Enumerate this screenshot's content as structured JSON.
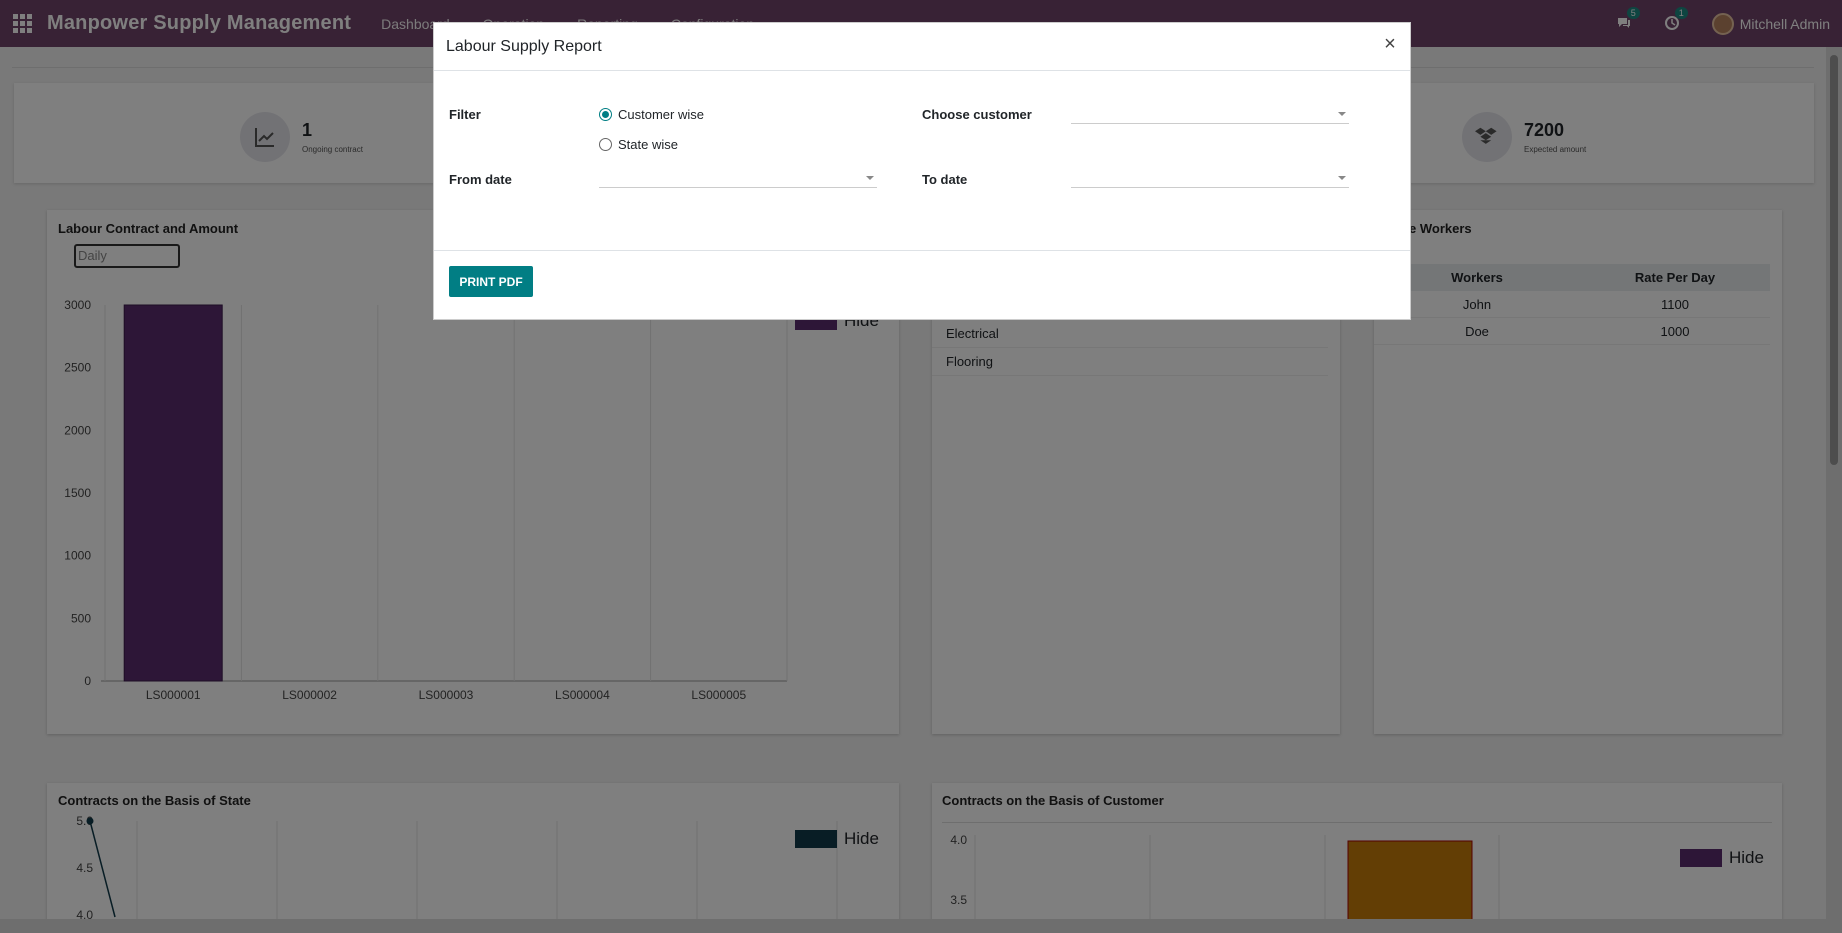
{
  "navbar": {
    "brand": "Manpower Supply Management",
    "menu": [
      "Dashboard",
      "Operation",
      "Reporting",
      "Configuration"
    ],
    "chat_count": "5",
    "activity_count": "1",
    "user_name": "Mitchell Admin"
  },
  "tiles": [
    {
      "value": "1",
      "label": "Ongoing contract",
      "icon": "trend-up-icon"
    },
    {
      "value": "7200",
      "label": "Expected amount",
      "icon": "dropbox-icon"
    }
  ],
  "contract_card": {
    "title": "Labour Contract and Amount",
    "period_select": "Daily",
    "legend": "Hide"
  },
  "category_list": [
    "Electrical",
    "Flooring"
  ],
  "workers_card": {
    "title": "ilable Workers",
    "headers": [
      "Workers",
      "Rate Per Day"
    ],
    "rows": [
      {
        "worker": "John",
        "rate": "1100"
      },
      {
        "worker": "Doe",
        "rate": "1000"
      }
    ]
  },
  "state_card": {
    "title": "Contracts on the Basis of State",
    "legend": "Hide"
  },
  "customer_card": {
    "title": "Contracts on the Basis of Customer",
    "legend": "Hide"
  },
  "modal": {
    "title": "Labour Supply Report",
    "close": "×",
    "filter_label": "Filter",
    "options": [
      "Customer wise",
      "State wise"
    ],
    "selected": "Customer wise",
    "customer_label": "Choose customer",
    "from_label": "From date",
    "to_label": "To date",
    "print_label": "PRINT PDF"
  },
  "colors": {
    "navbar": "#71456a",
    "primary": "#017e84",
    "bar_purple": "#5a2d6e",
    "bar_orange": "#c77d0a",
    "line_dark": "#103a4a"
  },
  "chart_data": [
    {
      "type": "bar",
      "categories": [
        "LS000001",
        "LS000002",
        "LS000003",
        "LS000004",
        "LS000005"
      ],
      "values": [
        3000,
        0,
        0,
        0,
        0
      ],
      "ylim": [
        0,
        3000
      ],
      "yticks": [
        0,
        500,
        1000,
        1500,
        2000,
        2500,
        3000
      ],
      "legend": "Hide"
    },
    {
      "type": "line",
      "yticks": [
        4.0,
        4.5,
        5.0
      ],
      "points_visible": [
        5.0
      ],
      "legend": "Hide"
    },
    {
      "type": "bar",
      "yticks": [
        3.5,
        4.0
      ],
      "legend": "Hide"
    }
  ]
}
